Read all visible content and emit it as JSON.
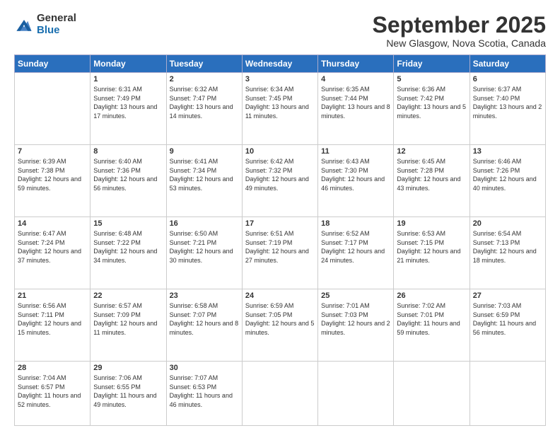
{
  "logo": {
    "general": "General",
    "blue": "Blue"
  },
  "header": {
    "month": "September 2025",
    "location": "New Glasgow, Nova Scotia, Canada"
  },
  "days_of_week": [
    "Sunday",
    "Monday",
    "Tuesday",
    "Wednesday",
    "Thursday",
    "Friday",
    "Saturday"
  ],
  "weeks": [
    [
      {
        "day": "",
        "sunrise": "",
        "sunset": "",
        "daylight": ""
      },
      {
        "day": "1",
        "sunrise": "Sunrise: 6:31 AM",
        "sunset": "Sunset: 7:49 PM",
        "daylight": "Daylight: 13 hours and 17 minutes."
      },
      {
        "day": "2",
        "sunrise": "Sunrise: 6:32 AM",
        "sunset": "Sunset: 7:47 PM",
        "daylight": "Daylight: 13 hours and 14 minutes."
      },
      {
        "day": "3",
        "sunrise": "Sunrise: 6:34 AM",
        "sunset": "Sunset: 7:45 PM",
        "daylight": "Daylight: 13 hours and 11 minutes."
      },
      {
        "day": "4",
        "sunrise": "Sunrise: 6:35 AM",
        "sunset": "Sunset: 7:44 PM",
        "daylight": "Daylight: 13 hours and 8 minutes."
      },
      {
        "day": "5",
        "sunrise": "Sunrise: 6:36 AM",
        "sunset": "Sunset: 7:42 PM",
        "daylight": "Daylight: 13 hours and 5 minutes."
      },
      {
        "day": "6",
        "sunrise": "Sunrise: 6:37 AM",
        "sunset": "Sunset: 7:40 PM",
        "daylight": "Daylight: 13 hours and 2 minutes."
      }
    ],
    [
      {
        "day": "7",
        "sunrise": "Sunrise: 6:39 AM",
        "sunset": "Sunset: 7:38 PM",
        "daylight": "Daylight: 12 hours and 59 minutes."
      },
      {
        "day": "8",
        "sunrise": "Sunrise: 6:40 AM",
        "sunset": "Sunset: 7:36 PM",
        "daylight": "Daylight: 12 hours and 56 minutes."
      },
      {
        "day": "9",
        "sunrise": "Sunrise: 6:41 AM",
        "sunset": "Sunset: 7:34 PM",
        "daylight": "Daylight: 12 hours and 53 minutes."
      },
      {
        "day": "10",
        "sunrise": "Sunrise: 6:42 AM",
        "sunset": "Sunset: 7:32 PM",
        "daylight": "Daylight: 12 hours and 49 minutes."
      },
      {
        "day": "11",
        "sunrise": "Sunrise: 6:43 AM",
        "sunset": "Sunset: 7:30 PM",
        "daylight": "Daylight: 12 hours and 46 minutes."
      },
      {
        "day": "12",
        "sunrise": "Sunrise: 6:45 AM",
        "sunset": "Sunset: 7:28 PM",
        "daylight": "Daylight: 12 hours and 43 minutes."
      },
      {
        "day": "13",
        "sunrise": "Sunrise: 6:46 AM",
        "sunset": "Sunset: 7:26 PM",
        "daylight": "Daylight: 12 hours and 40 minutes."
      }
    ],
    [
      {
        "day": "14",
        "sunrise": "Sunrise: 6:47 AM",
        "sunset": "Sunset: 7:24 PM",
        "daylight": "Daylight: 12 hours and 37 minutes."
      },
      {
        "day": "15",
        "sunrise": "Sunrise: 6:48 AM",
        "sunset": "Sunset: 7:22 PM",
        "daylight": "Daylight: 12 hours and 34 minutes."
      },
      {
        "day": "16",
        "sunrise": "Sunrise: 6:50 AM",
        "sunset": "Sunset: 7:21 PM",
        "daylight": "Daylight: 12 hours and 30 minutes."
      },
      {
        "day": "17",
        "sunrise": "Sunrise: 6:51 AM",
        "sunset": "Sunset: 7:19 PM",
        "daylight": "Daylight: 12 hours and 27 minutes."
      },
      {
        "day": "18",
        "sunrise": "Sunrise: 6:52 AM",
        "sunset": "Sunset: 7:17 PM",
        "daylight": "Daylight: 12 hours and 24 minutes."
      },
      {
        "day": "19",
        "sunrise": "Sunrise: 6:53 AM",
        "sunset": "Sunset: 7:15 PM",
        "daylight": "Daylight: 12 hours and 21 minutes."
      },
      {
        "day": "20",
        "sunrise": "Sunrise: 6:54 AM",
        "sunset": "Sunset: 7:13 PM",
        "daylight": "Daylight: 12 hours and 18 minutes."
      }
    ],
    [
      {
        "day": "21",
        "sunrise": "Sunrise: 6:56 AM",
        "sunset": "Sunset: 7:11 PM",
        "daylight": "Daylight: 12 hours and 15 minutes."
      },
      {
        "day": "22",
        "sunrise": "Sunrise: 6:57 AM",
        "sunset": "Sunset: 7:09 PM",
        "daylight": "Daylight: 12 hours and 11 minutes."
      },
      {
        "day": "23",
        "sunrise": "Sunrise: 6:58 AM",
        "sunset": "Sunset: 7:07 PM",
        "daylight": "Daylight: 12 hours and 8 minutes."
      },
      {
        "day": "24",
        "sunrise": "Sunrise: 6:59 AM",
        "sunset": "Sunset: 7:05 PM",
        "daylight": "Daylight: 12 hours and 5 minutes."
      },
      {
        "day": "25",
        "sunrise": "Sunrise: 7:01 AM",
        "sunset": "Sunset: 7:03 PM",
        "daylight": "Daylight: 12 hours and 2 minutes."
      },
      {
        "day": "26",
        "sunrise": "Sunrise: 7:02 AM",
        "sunset": "Sunset: 7:01 PM",
        "daylight": "Daylight: 11 hours and 59 minutes."
      },
      {
        "day": "27",
        "sunrise": "Sunrise: 7:03 AM",
        "sunset": "Sunset: 6:59 PM",
        "daylight": "Daylight: 11 hours and 56 minutes."
      }
    ],
    [
      {
        "day": "28",
        "sunrise": "Sunrise: 7:04 AM",
        "sunset": "Sunset: 6:57 PM",
        "daylight": "Daylight: 11 hours and 52 minutes."
      },
      {
        "day": "29",
        "sunrise": "Sunrise: 7:06 AM",
        "sunset": "Sunset: 6:55 PM",
        "daylight": "Daylight: 11 hours and 49 minutes."
      },
      {
        "day": "30",
        "sunrise": "Sunrise: 7:07 AM",
        "sunset": "Sunset: 6:53 PM",
        "daylight": "Daylight: 11 hours and 46 minutes."
      },
      {
        "day": "",
        "sunrise": "",
        "sunset": "",
        "daylight": ""
      },
      {
        "day": "",
        "sunrise": "",
        "sunset": "",
        "daylight": ""
      },
      {
        "day": "",
        "sunrise": "",
        "sunset": "",
        "daylight": ""
      },
      {
        "day": "",
        "sunrise": "",
        "sunset": "",
        "daylight": ""
      }
    ]
  ]
}
